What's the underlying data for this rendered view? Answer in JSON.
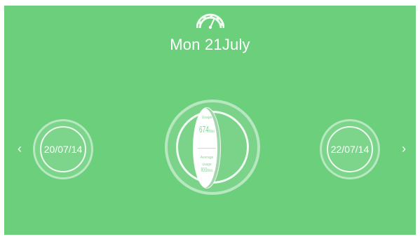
{
  "header": {
    "title": "Mon 21July",
    "icon": "speedometer-icon"
  },
  "navigation": {
    "prev_arrow": "‹",
    "next_arrow": "›"
  },
  "days": {
    "previous": "20/07/14",
    "next": "22/07/14"
  },
  "today_card": {
    "usage_label": "Usage",
    "usage_value": "674",
    "usage_unit": "litres",
    "average_label": "Average",
    "average_sub_label": "usage",
    "average_value": "800",
    "average_unit": "litres"
  },
  "colors": {
    "background": "#6bcf7c",
    "foreground": "#ffffff",
    "card_text": "#8fd49a"
  }
}
